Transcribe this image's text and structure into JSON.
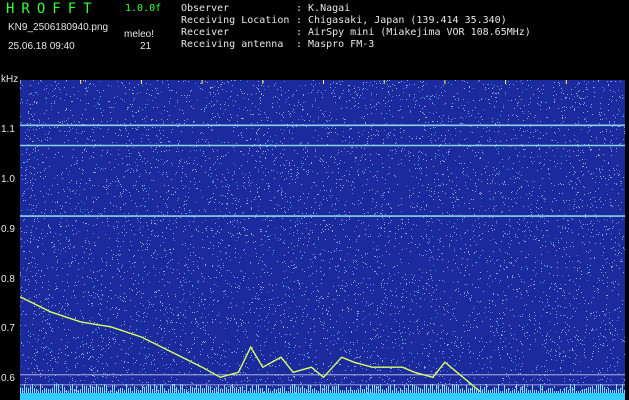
{
  "header": {
    "title": "HROFFT",
    "version": "1.0.0f",
    "filename": "KN9_2506180940.png",
    "datetime": "25.06.18 09:40",
    "mode": "meleo!",
    "count": "21",
    "info": [
      {
        "label": "Observer",
        "value": ": K.Nagai"
      },
      {
        "label": "Receiving Location",
        "value": ": Chigasaki, Japan (139.414 35.340)"
      },
      {
        "label": "Receiver",
        "value": ": AirSpy mini (Miakejima VOR 108.65MHz)"
      },
      {
        "label": "Receiving antenna",
        "value": ": Maspro FM-3"
      }
    ]
  },
  "chart_data": {
    "type": "heatmap",
    "ylabel": "kHz",
    "x_tick_labels": [
      "0941",
      "0942",
      "0943",
      "0944",
      "0945",
      "0946",
      "0947",
      "0948",
      "0949",
      "0950"
    ],
    "y_tick_labels": [
      "1.1",
      "1.0",
      "0.9",
      "0.8",
      "0.7",
      "0.6"
    ],
    "y_ticks": [
      1.1,
      1.0,
      0.9,
      0.8,
      0.7,
      0.6
    ],
    "ylim": [
      0.565,
      1.2
    ],
    "steady_signals_khz": [
      1.11,
      1.07,
      0.93
    ],
    "reference_lines_khz": [
      0.615,
      0.595
    ],
    "drifting_signal": {
      "x_minutes": [
        0.0,
        0.5,
        1.0,
        1.5,
        2.0,
        2.5,
        3.0,
        3.3,
        3.6,
        3.8,
        4.0,
        4.3,
        4.5,
        4.8,
        5.0,
        5.3,
        5.5,
        5.8,
        6.0,
        6.3,
        6.5,
        6.8,
        7.0,
        7.2,
        7.4,
        7.6
      ],
      "y_khz": [
        0.77,
        0.74,
        0.72,
        0.71,
        0.69,
        0.66,
        0.63,
        0.61,
        0.62,
        0.67,
        0.63,
        0.65,
        0.62,
        0.63,
        0.61,
        0.65,
        0.64,
        0.63,
        0.63,
        0.63,
        0.62,
        0.61,
        0.64,
        0.62,
        0.6,
        0.58
      ]
    },
    "colors": {
      "background": "#1b2a9c",
      "noise": "#ffffff",
      "signal": "#9ef0ff",
      "trace": "#d8ff66",
      "floor": "#33ccff",
      "tick_labels_x": "#ffff66"
    }
  }
}
